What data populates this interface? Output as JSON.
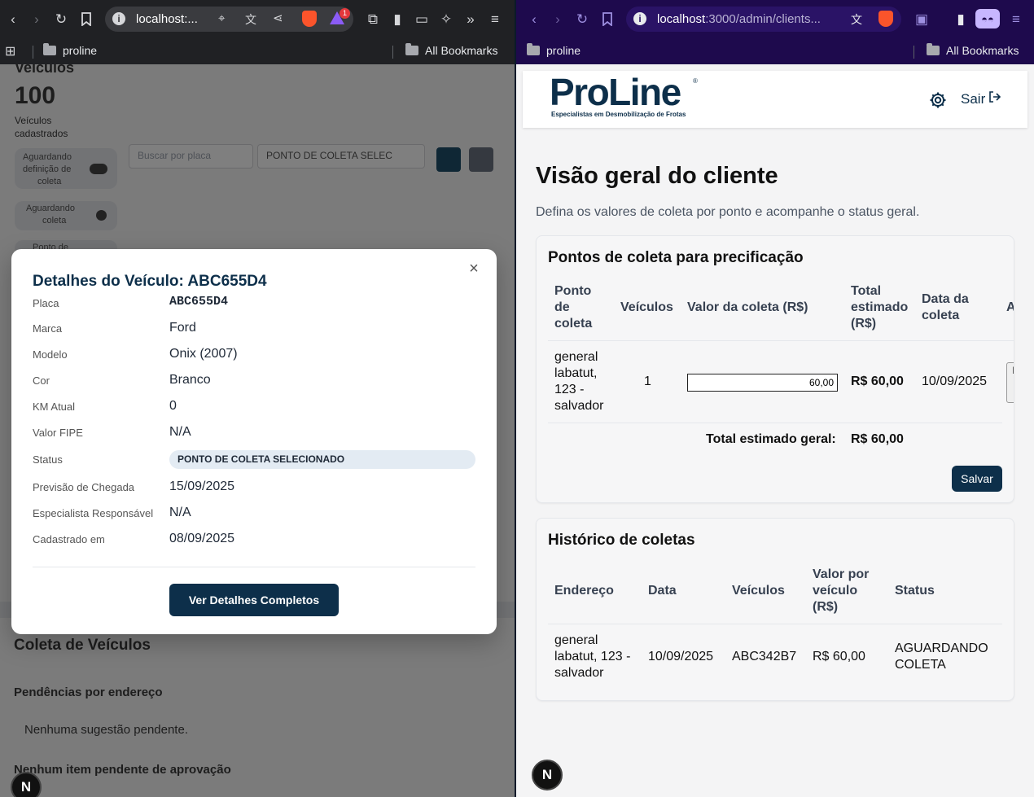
{
  "left_browser": {
    "url": "localhost:...",
    "bookmark_folder": "proline",
    "all_bookmarks": "All Bookmarks",
    "notification_count": "1"
  },
  "right_browser": {
    "url_host": "localhost",
    "url_path": ":3000/admin/clients...",
    "bookmark_folder": "proline",
    "all_bookmarks": "All Bookmarks"
  },
  "left_page": {
    "heading": "Veículos",
    "count": "100",
    "count_caption_line1": "Veículos",
    "count_caption_line2": "cadastrados",
    "filter_awaiting_definition_line1": "Aguardando",
    "filter_awaiting_definition_line2": "definição de",
    "filter_awaiting_definition_line3": "coleta",
    "filter_awaiting_collection_line1": "Aguardando",
    "filter_awaiting_collection_line2": "coleta",
    "filter_ponto_line1": "Ponto de",
    "search_placeholder": "Buscar por placa",
    "status_filter_value": "PONTO DE COLETA SELEC",
    "section_coleta": "Coleta de Veículos",
    "section_pendencias": "Pendências por endereço",
    "no_suggestion": "Nenhuma sugestão pendente.",
    "no_pending_items": "Nenhum item pendente de aprovação"
  },
  "modal": {
    "title": "Detalhes do Veículo: ABC655D4",
    "close_symbol": "×",
    "fields": [
      {
        "label": "Placa",
        "value": "ABC655D4"
      },
      {
        "label": "Marca",
        "value": "Ford"
      },
      {
        "label": "Modelo",
        "value": "Onix (2007)"
      },
      {
        "label": "Cor",
        "value": "Branco"
      },
      {
        "label": "KM Atual",
        "value": "0"
      },
      {
        "label": "Valor FIPE",
        "value": "N/A"
      },
      {
        "label": "Status",
        "value": "PONTO DE COLETA SELECIONADO"
      },
      {
        "label": "Previsão de Chegada",
        "value": "15/09/2025"
      },
      {
        "label": "Especialista Responsável",
        "value": "N/A"
      },
      {
        "label": "Cadastrado em",
        "value": "08/09/2025"
      }
    ],
    "button_label": "Ver Detalhes Completos"
  },
  "next_badge_letter": "N",
  "right_page": {
    "logo_text": "ProLine",
    "logo_tm": "®",
    "logo_tagline": "Especialistas em Desmobilização de Frotas",
    "logout_label": "Sair",
    "page_title": "Visão geral do cliente",
    "page_subtitle": "Defina os valores de coleta por ponto e acompanhe o status geral.",
    "pontos": {
      "title": "Pontos de coleta para precificação",
      "headers": {
        "ponto_l1": "Ponto",
        "ponto_l2": "de",
        "ponto_l3": "coleta",
        "veiculos": "Veículos",
        "valor": "Valor da coleta (R$)",
        "total_l1": "Total",
        "total_l2": "estimado",
        "total_l3": "(R$)",
        "data_l1": "Data da",
        "data_l2": "coleta",
        "acoes": "Ações"
      },
      "row": {
        "endereco_l1": "general",
        "endereco_l2": "labatut,",
        "endereco_l3": "123 -",
        "endereco_l4": "salvador",
        "veiculos": "1",
        "valor_input": "60,00",
        "total": "R$ 60,00",
        "data": "10/09/2025",
        "acao_l1": "Prop",
        "acao_l2": "nov",
        "acao_l3": "dat"
      },
      "total_geral_label": "Total estimado geral:",
      "total_geral_value": "R$ 60,00",
      "save_label": "Salvar"
    },
    "historico": {
      "title": "Histórico de coletas",
      "headers": {
        "endereco": "Endereço",
        "data": "Data",
        "veiculos": "Veículos",
        "valor_l1": "Valor por",
        "valor_l2": "veículo",
        "valor_l3": "(R$)",
        "status": "Status"
      },
      "row": {
        "endereco_l1": "general",
        "endereco_l2": "labatut, 123 -",
        "endereco_l3": "salvador",
        "data": "10/09/2025",
        "veiculos": "ABC342B7",
        "valor": "R$ 60,00",
        "status_l1": "AGUARDANDO",
        "status_l2": "COLETA"
      }
    }
  },
  "colors": {
    "brand_navy": "#0d2f4a",
    "right_chrome": "#1e0a4d",
    "left_chrome": "#202124",
    "status_badge_bg": "#e3ebf3"
  }
}
